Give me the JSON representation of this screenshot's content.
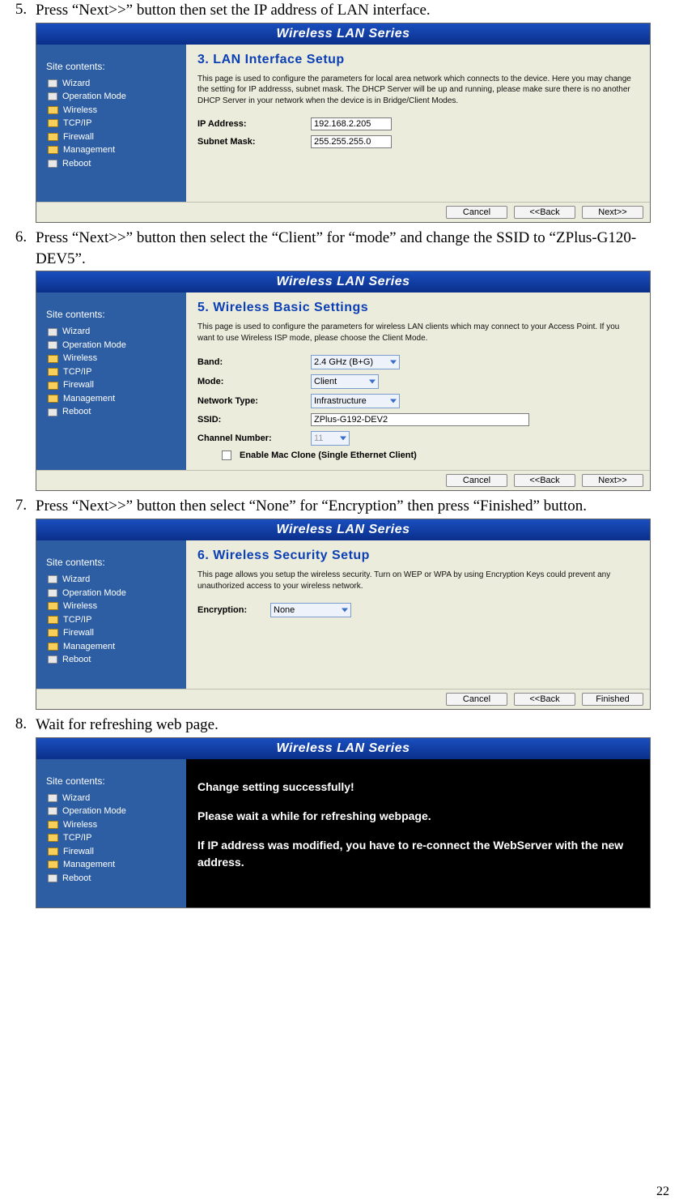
{
  "page_number": "22",
  "steps": {
    "s5": {
      "num": "5.",
      "text": "Press “Next>>” button then set the IP address of LAN interface."
    },
    "s6": {
      "num": "6.",
      "text": "Press “Next>>” button then select the “Client” for “mode” and change the SSID to “ZPlus-G120-DEV5”."
    },
    "s7": {
      "num": "7.",
      "text": "Press “Next>>” button then select “None” for “Encryption” then press “Finished” button."
    },
    "s8": {
      "num": "8.",
      "text": "Wait for refreshing web page."
    }
  },
  "common": {
    "app_title": "Wireless LAN Series",
    "sidebar_title": "Site contents:",
    "sidebar_items": [
      {
        "label": "Wizard",
        "icon": "file"
      },
      {
        "label": "Operation Mode",
        "icon": "file"
      },
      {
        "label": "Wireless",
        "icon": "folder"
      },
      {
        "label": "TCP/IP",
        "icon": "folder"
      },
      {
        "label": "Firewall",
        "icon": "folder"
      },
      {
        "label": "Management",
        "icon": "folder"
      },
      {
        "label": "Reboot",
        "icon": "file"
      }
    ],
    "btn_cancel": "Cancel",
    "btn_back": "<<Back",
    "btn_next": "Next>>",
    "btn_finished": "Finished"
  },
  "panel_lan": {
    "title": "3. LAN Interface Setup",
    "desc": "This page is used to configure the parameters for local area network which connects to the device. Here you may change the setting for IP addresss, subnet mask. The DHCP Server will be up and running, please make sure there is no another DHCP Server in your network when the device is in Bridge/Client Modes.",
    "ip_label": "IP Address:",
    "ip_value": "192.168.2.205",
    "mask_label": "Subnet Mask:",
    "mask_value": "255.255.255.0"
  },
  "panel_wireless": {
    "title": "5. Wireless Basic Settings",
    "desc": "This page is used to configure the parameters for wireless LAN clients which may connect to your Access Point. If you want to use Wireless ISP mode, please choose the Client Mode.",
    "band_label": "Band:",
    "band_value": "2.4 GHz (B+G)",
    "mode_label": "Mode:",
    "mode_value": "Client",
    "nettype_label": "Network Type:",
    "nettype_value": "Infrastructure",
    "ssid_label": "SSID:",
    "ssid_value": "ZPlus-G192-DEV2",
    "channel_label": "Channel Number:",
    "channel_value": "11",
    "mac_clone": "Enable Mac Clone (Single Ethernet Client)"
  },
  "panel_security": {
    "title": "6. Wireless Security Setup",
    "desc": "This page allows you setup the wireless security. Turn on WEP or WPA by using Encryption Keys could prevent any unauthorized access to your wireless network.",
    "enc_label": "Encryption:",
    "enc_value": "None"
  },
  "panel_success": {
    "line1": "Change setting successfully!",
    "line2": "Please wait a while for refreshing webpage.",
    "line3": "If IP address was modified, you have to re-connect the WebServer with the new address."
  }
}
